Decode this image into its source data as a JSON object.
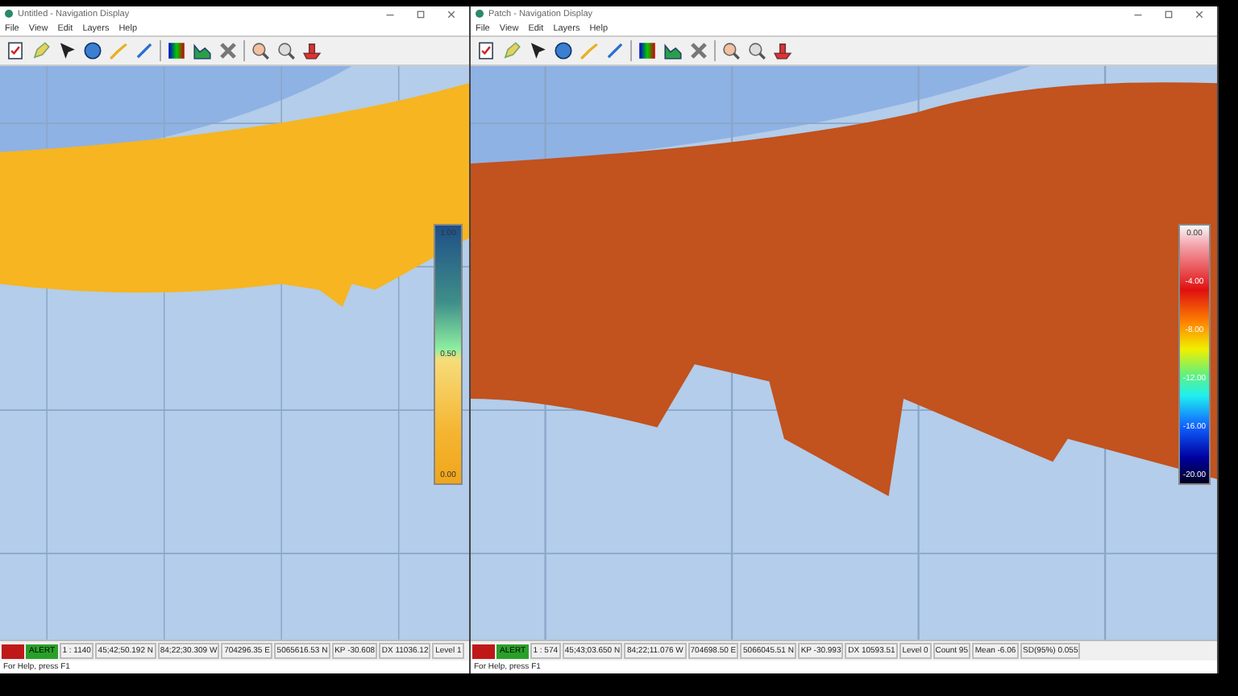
{
  "windows": [
    {
      "title": "Untitled - Navigation Display",
      "menu": [
        "File",
        "View",
        "Edit",
        "Layers",
        "Help"
      ],
      "map": {
        "kind": "quality"
      },
      "legend": {
        "kind": "quality",
        "labels": [
          "1.00",
          "0.50",
          "0.00"
        ]
      },
      "status": {
        "alert": "ALERT",
        "cells": [
          "1 : 1140",
          "45;42;50.192 N",
          "84;22;30.309 W",
          "704296.35 E",
          "5065616.53 N",
          "KP -30.608",
          "DX 11036.12",
          "Level 1"
        ]
      },
      "help": "For Help, press F1"
    },
    {
      "title": "Patch - Navigation Display",
      "menu": [
        "File",
        "View",
        "Edit",
        "Layers",
        "Help"
      ],
      "map": {
        "kind": "depth"
      },
      "legend": {
        "kind": "depth",
        "labels": [
          "0.00",
          "-4.00",
          "-8.00",
          "-12.00",
          "-16.00",
          "-20.00"
        ]
      },
      "status": {
        "alert": "ALERT",
        "cells": [
          "1 : 574",
          "45;43;03.650 N",
          "84;22;11.076 W",
          "704698.50 E",
          "5066045.51 N",
          "KP -30.993",
          "DX 10593.51",
          "Level 0",
          "Count 95",
          "Mean -6.06",
          "SD(95%) 0.055"
        ]
      },
      "help": "For Help, press F1"
    }
  ]
}
